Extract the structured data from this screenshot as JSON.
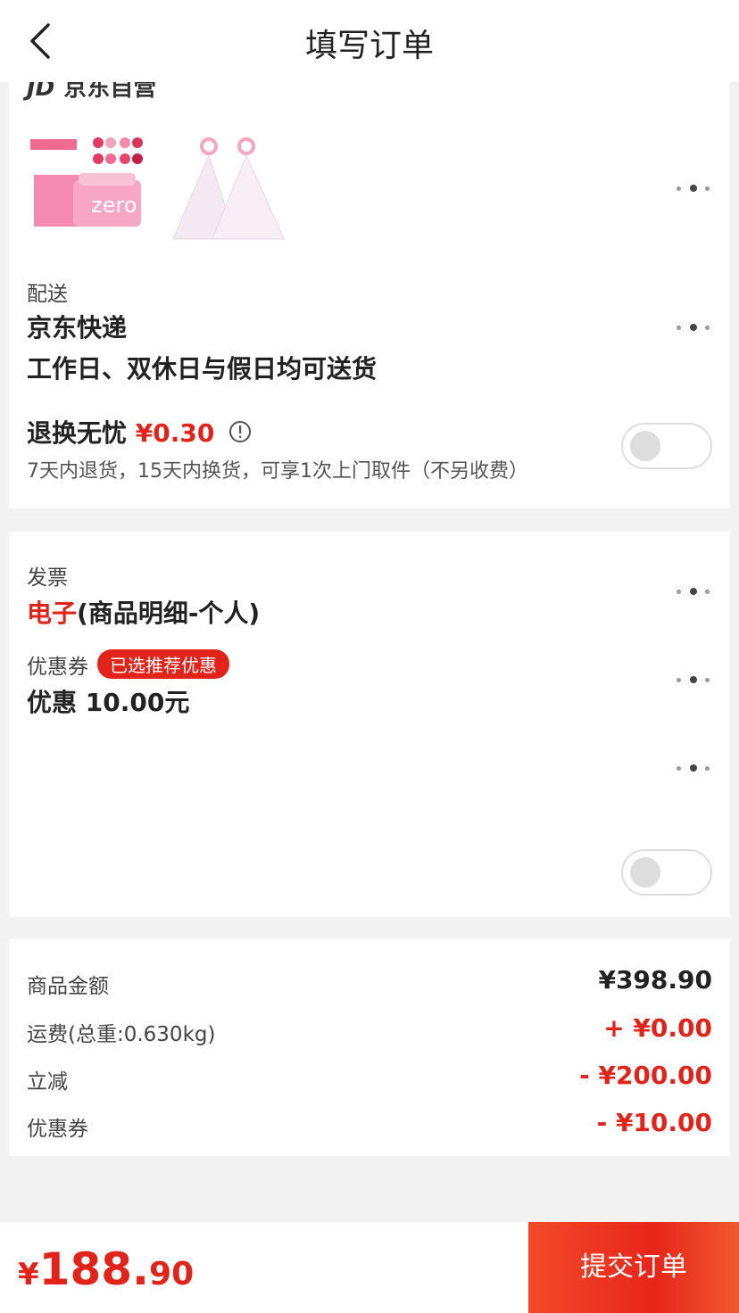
{
  "header": {
    "title": "填写订单",
    "back_icon": "chevron-left-icon"
  },
  "store": {
    "logo": "JD",
    "name": "京东自营"
  },
  "delivery": {
    "label": "配送",
    "carrier": "京东快递",
    "schedule": "工作日、双休日与假日均可送货"
  },
  "return_service": {
    "title": "退换无忧",
    "price": "¥0.30",
    "desc": "7天内退货，15天内换货，可享1次上门取件（不另收费）",
    "enabled": false
  },
  "invoice": {
    "label": "发票",
    "type": "电子",
    "detail": "(商品明细-个人)"
  },
  "coupon": {
    "label": "优惠券",
    "badge": "已选推荐优惠",
    "value": "优惠 10.00元"
  },
  "summary": [
    {
      "label": "商品金额",
      "value": "¥398.90",
      "color": "#222222"
    },
    {
      "label": "运费(总重:0.630kg)",
      "value": "+ ¥0.00",
      "color": "#e2231a"
    },
    {
      "label": "立减",
      "value": "- ¥200.00",
      "color": "#e2231a"
    },
    {
      "label": "优惠券",
      "value": "- ¥10.00",
      "color": "#e2231a"
    }
  ],
  "footer": {
    "currency": "¥",
    "total_int": "188.",
    "total_dec": "90",
    "submit_label": "提交订单"
  },
  "colors": {
    "accent": "#e2231a"
  }
}
